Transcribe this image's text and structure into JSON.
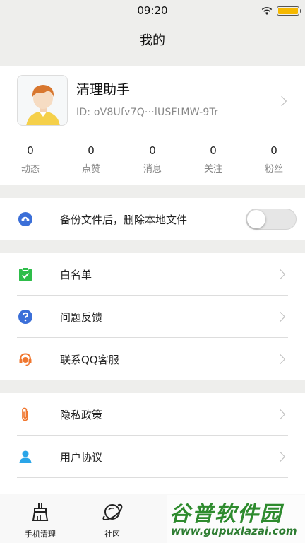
{
  "status": {
    "time": "09:20",
    "battery_color": "#f5b800"
  },
  "nav": {
    "title": "我的"
  },
  "profile": {
    "name": "清理助手",
    "id": "ID: oV8Ufv7Q···lUSFtMW-9Tr",
    "stats": [
      {
        "value": "0",
        "label": "动态"
      },
      {
        "value": "0",
        "label": "点赞"
      },
      {
        "value": "0",
        "label": "消息"
      },
      {
        "value": "0",
        "label": "关注"
      },
      {
        "value": "0",
        "label": "粉丝"
      }
    ]
  },
  "backup": {
    "label": "备份文件后，删除本地文件",
    "toggle_on": false
  },
  "menu": {
    "whitelist": "白名单",
    "feedback": "问题反馈",
    "qq_service": "联系QQ客服",
    "privacy": "隐私政策",
    "agreement": "用户协议"
  },
  "tabs": [
    {
      "label": "手机清理",
      "icon": "broom-icon"
    },
    {
      "label": "社区",
      "icon": "planet-icon"
    }
  ],
  "watermark": {
    "title": "谷普软件园",
    "url": "www.gupuxlazai.com"
  },
  "colors": {
    "green": "#2ebd4a",
    "blue": "#3b6fd8",
    "orange": "#f0772f",
    "cyan": "#2aa5e8"
  }
}
